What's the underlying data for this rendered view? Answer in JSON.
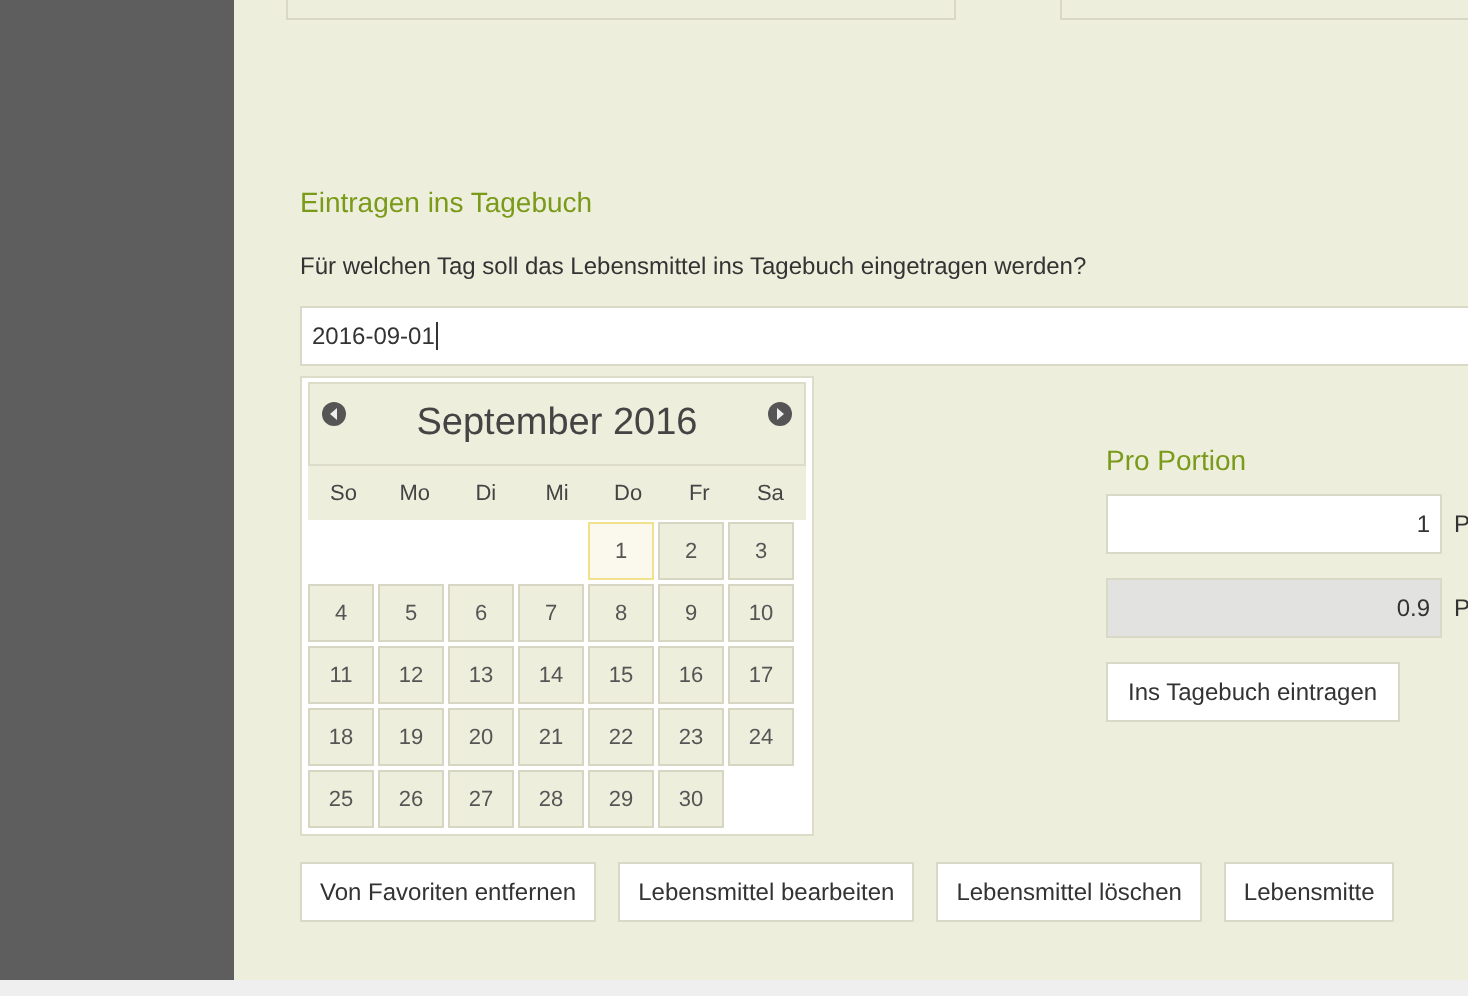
{
  "heading": "Eintragen ins Tagebuch",
  "question": "Für welchen Tag soll das Lebensmittel ins Tagebuch eingetragen werden?",
  "date_field": {
    "value": "2016-09-01"
  },
  "calendar": {
    "title": "September 2016",
    "weekdays": [
      "So",
      "Mo",
      "Di",
      "Mi",
      "Do",
      "Fr",
      "Sa"
    ],
    "weeks": [
      [
        {
          "day": "1",
          "selected": true
        },
        {
          "day": "2",
          "selected": false
        },
        {
          "day": "3",
          "selected": false
        }
      ],
      [
        {
          "day": "4",
          "selected": false
        },
        {
          "day": "5",
          "selected": false
        },
        {
          "day": "6",
          "selected": false
        },
        {
          "day": "7",
          "selected": false
        },
        {
          "day": "8",
          "selected": false
        },
        {
          "day": "9",
          "selected": false
        },
        {
          "day": "10",
          "selected": false
        }
      ],
      [
        {
          "day": "11",
          "selected": false
        },
        {
          "day": "12",
          "selected": false
        },
        {
          "day": "13",
          "selected": false
        },
        {
          "day": "14",
          "selected": false
        },
        {
          "day": "15",
          "selected": false
        },
        {
          "day": "16",
          "selected": false
        },
        {
          "day": "17",
          "selected": false
        }
      ],
      [
        {
          "day": "18",
          "selected": false
        },
        {
          "day": "19",
          "selected": false
        },
        {
          "day": "20",
          "selected": false
        },
        {
          "day": "21",
          "selected": false
        },
        {
          "day": "22",
          "selected": false
        },
        {
          "day": "23",
          "selected": false
        },
        {
          "day": "24",
          "selected": false
        }
      ],
      [
        {
          "day": "25",
          "selected": false
        },
        {
          "day": "26",
          "selected": false
        },
        {
          "day": "27",
          "selected": false
        },
        {
          "day": "28",
          "selected": false
        },
        {
          "day": "29",
          "selected": false
        },
        {
          "day": "30",
          "selected": false
        }
      ]
    ]
  },
  "portion": {
    "heading": "Pro Portion",
    "fields": [
      {
        "value": "1",
        "unit": "P",
        "disabled": false
      },
      {
        "value": "0.9",
        "unit": "P",
        "disabled": true
      }
    ],
    "button": "Ins Tagebuch eintragen"
  },
  "buttons": [
    "Von Favoriten entfernen",
    "Lebensmittel bearbeiten",
    "Lebensmittel löschen",
    "Lebensmitte"
  ]
}
